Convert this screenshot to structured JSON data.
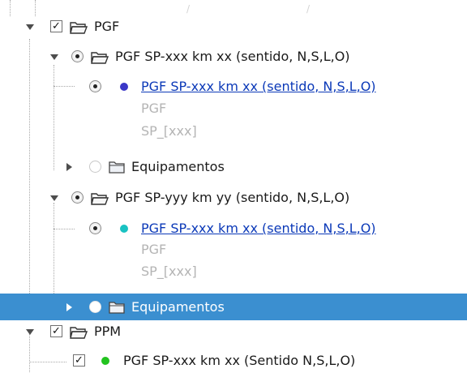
{
  "tree": {
    "decor_marks": [
      "/",
      "/"
    ],
    "nodes": [
      {
        "label": "PGF",
        "children": [
          {
            "label": "PGF SP-xxx km xx (sentido, N,S,L,O)",
            "children": [
              {
                "label": "PGF SP-xxx km xx (sentido, N,S,L,O)",
                "dot_color": "#3a37c7",
                "details": [
                  "PGF",
                  "SP_[xxx]"
                ]
              },
              {
                "label": "Equipamentos"
              }
            ]
          },
          {
            "label": "PGF SP-yyy km yy (sentido, N,S,L,O)",
            "children": [
              {
                "label": "PGF SP-xxx km xx (sentido, N,S,L,O)",
                "dot_color": "#19c2c2",
                "details": [
                  "PGF",
                  "SP_[xxx]"
                ]
              },
              {
                "label": "Equipamentos",
                "selected": true
              }
            ]
          }
        ]
      },
      {
        "label": "PPM",
        "children": [
          {
            "label": "PGF SP-xxx km xx (Sentido N,S,L,O)",
            "dot_color": "#22c31f"
          }
        ]
      }
    ],
    "check_mark": "✓"
  },
  "colors": {
    "selection": "#3b8fd0",
    "link": "#0b39b8",
    "muted": "#b4b4b4"
  }
}
